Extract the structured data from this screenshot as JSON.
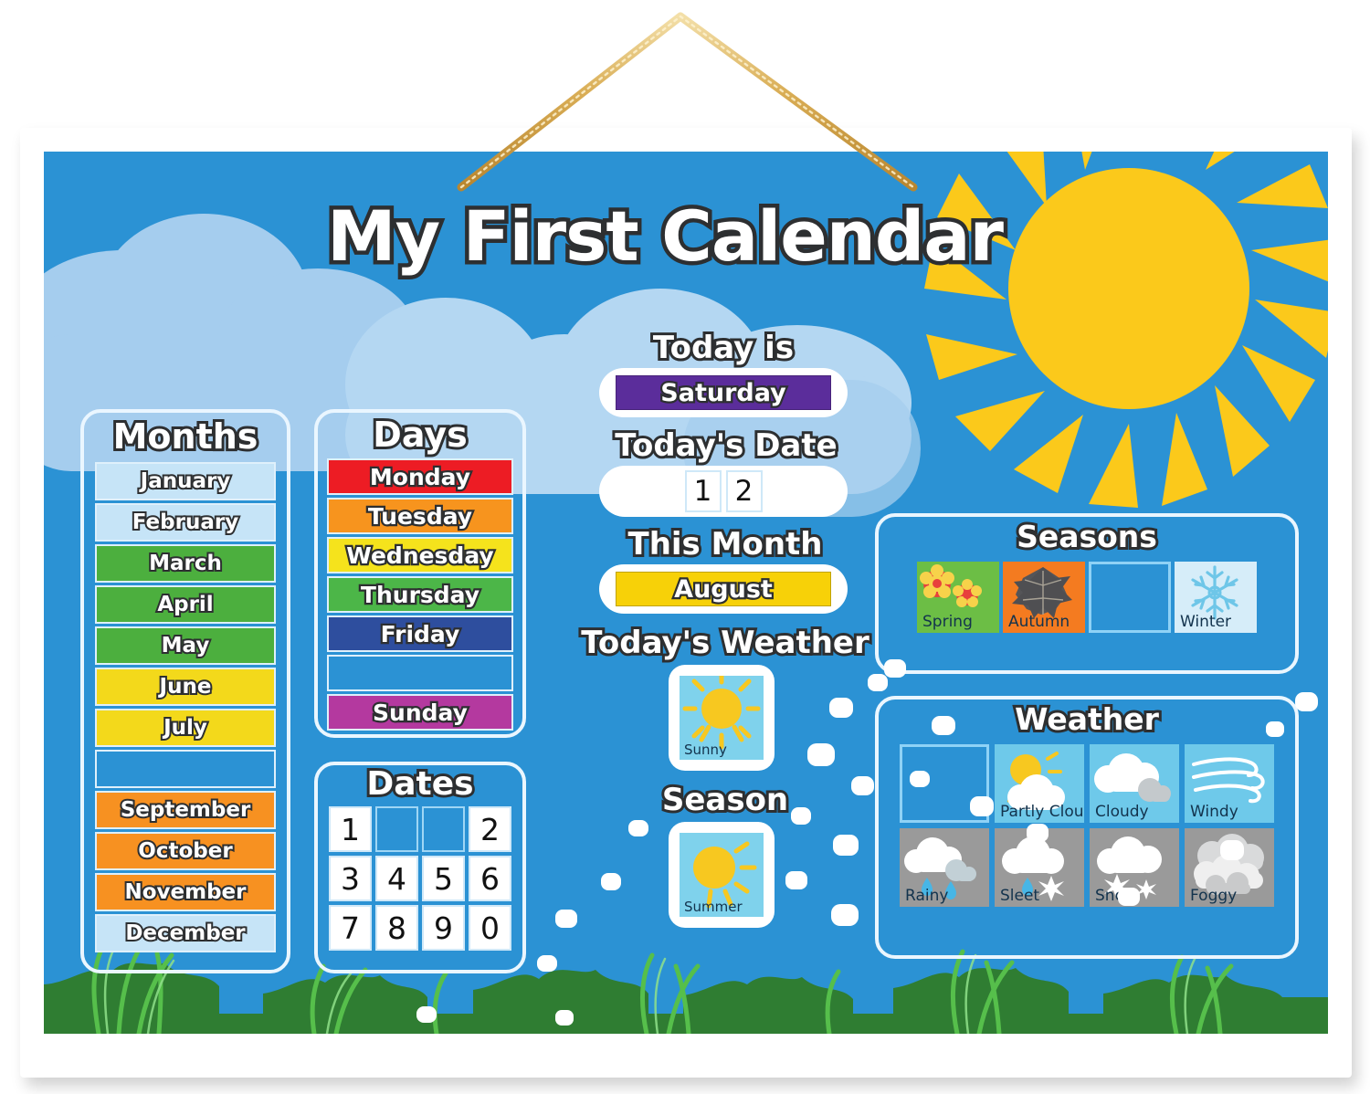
{
  "board": {
    "title": "My First Calendar",
    "background_color": "#2b92d4",
    "frame_color": "#ffffff",
    "hanger": "gold-rope"
  },
  "months": {
    "heading": "Months",
    "items": [
      {
        "label": "January",
        "color": "#c6e4f7",
        "empty": false
      },
      {
        "label": "February",
        "color": "#c6e4f7",
        "empty": false
      },
      {
        "label": "March",
        "color": "#4caf3e",
        "empty": false
      },
      {
        "label": "April",
        "color": "#4caf3e",
        "empty": false
      },
      {
        "label": "May",
        "color": "#4caf3e",
        "empty": false
      },
      {
        "label": "June",
        "color": "#f3d91b",
        "empty": false
      },
      {
        "label": "July",
        "color": "#f3d91b",
        "empty": false
      },
      {
        "label": "",
        "color": "#2b92d4",
        "empty": true
      },
      {
        "label": "September",
        "color": "#f79121",
        "empty": false
      },
      {
        "label": "October",
        "color": "#f79121",
        "empty": false
      },
      {
        "label": "November",
        "color": "#f79121",
        "empty": false
      },
      {
        "label": "December",
        "color": "#c6e4f7",
        "empty": false
      }
    ]
  },
  "days": {
    "heading": "Days",
    "items": [
      {
        "label": "Monday",
        "color": "#ed1c24",
        "empty": false
      },
      {
        "label": "Tuesday",
        "color": "#f7941e",
        "empty": false
      },
      {
        "label": "Wednesday",
        "color": "#f5e31c",
        "empty": false
      },
      {
        "label": "Thursday",
        "color": "#4cb648",
        "empty": false
      },
      {
        "label": "Friday",
        "color": "#2e4e9e",
        "empty": false
      },
      {
        "label": "",
        "color": "#2b92d4",
        "empty": true
      },
      {
        "label": "Sunday",
        "color": "#b4399f",
        "empty": false
      }
    ]
  },
  "dates": {
    "heading": "Dates",
    "cells": [
      {
        "label": "1",
        "empty": false
      },
      {
        "label": "",
        "empty": true
      },
      {
        "label": "",
        "empty": true
      },
      {
        "label": "2",
        "empty": false
      },
      {
        "label": "3",
        "empty": false
      },
      {
        "label": "4",
        "empty": false
      },
      {
        "label": "5",
        "empty": false
      },
      {
        "label": "6",
        "empty": false
      },
      {
        "label": "7",
        "empty": false
      },
      {
        "label": "8",
        "empty": false
      },
      {
        "label": "9",
        "empty": false
      },
      {
        "label": "0",
        "empty": false
      }
    ]
  },
  "today": {
    "day_label": "Today is",
    "day_value": "Saturday",
    "day_color": "#5b2d9b",
    "date_label": "Today's Date",
    "date_digits": [
      "1",
      "2"
    ],
    "month_label": "This Month",
    "month_value": "August",
    "month_color": "#f7d108",
    "weather_label": "Today's Weather",
    "weather_value": "Sunny",
    "season_label": "Season",
    "season_value": "Summer"
  },
  "seasons": {
    "heading": "Seasons",
    "items": [
      {
        "label": "Spring",
        "color": "#6cbe45",
        "icon": "flowers-icon",
        "empty": false
      },
      {
        "label": "Autumn",
        "color": "#f47b20",
        "icon": "leaf-icon",
        "empty": false
      },
      {
        "label": "",
        "color": "#2b92d4",
        "icon": "",
        "empty": true
      },
      {
        "label": "Winter",
        "color": "#d6edf9",
        "icon": "snowflake-icon",
        "empty": false
      }
    ]
  },
  "weather": {
    "heading": "Weather",
    "items": [
      {
        "label": "",
        "color": "#2b92d4",
        "icon": "",
        "empty": true
      },
      {
        "label": "Partly Cloudy",
        "color": "#6ec9ea",
        "icon": "sun-cloud-icon",
        "empty": false
      },
      {
        "label": "Cloudy",
        "color": "#6ec9ea",
        "icon": "cloud-icon",
        "empty": false
      },
      {
        "label": "Windy",
        "color": "#6ec9ea",
        "icon": "wind-icon",
        "empty": false
      },
      {
        "label": "Rainy",
        "color": "#9a9a9a",
        "icon": "rain-cloud-icon",
        "empty": false
      },
      {
        "label": "Sleet",
        "color": "#9a9a9a",
        "icon": "sleet-cloud-icon",
        "empty": false
      },
      {
        "label": "Snow",
        "color": "#9a9a9a",
        "icon": "snow-cloud-icon",
        "empty": false
      },
      {
        "label": "Foggy",
        "color": "#9a9a9a",
        "icon": "fog-icon",
        "empty": false
      }
    ]
  }
}
